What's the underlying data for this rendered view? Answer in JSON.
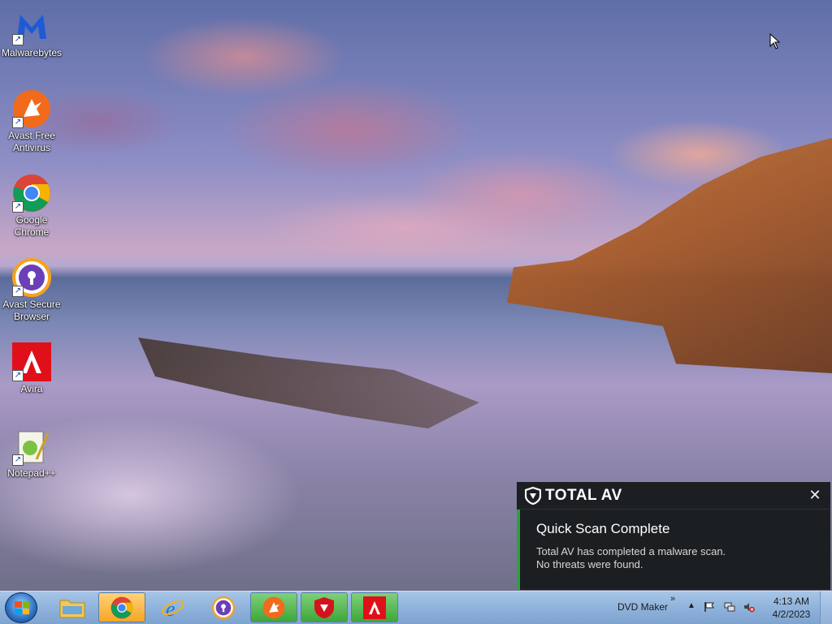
{
  "desktop": {
    "icons": [
      {
        "label": "Malwarebytes",
        "icon": "malwarebytes-icon"
      },
      {
        "label": "Avast Free Antivirus",
        "icon": "avast-antivirus-icon"
      },
      {
        "label": "Google Chrome",
        "icon": "chrome-icon"
      },
      {
        "label": "Avast Secure Browser",
        "icon": "avast-browser-icon"
      },
      {
        "label": "Avira",
        "icon": "avira-icon"
      },
      {
        "label": "Notepad++",
        "icon": "notepadpp-icon"
      }
    ]
  },
  "notification": {
    "brand": "TOTAL AV",
    "title": "Quick Scan Complete",
    "line1": "Total AV has completed a malware scan.",
    "line2": "No threats were found.",
    "close": "✕",
    "accent": "#2ea043"
  },
  "taskbar": {
    "pinned": [
      {
        "name": "explorer",
        "icon": "folder-icon"
      },
      {
        "name": "chrome",
        "icon": "chrome-icon"
      },
      {
        "name": "ie",
        "icon": "internet-explorer-icon"
      },
      {
        "name": "avast-browser",
        "icon": "avast-browser-icon"
      },
      {
        "name": "avast",
        "icon": "avast-antivirus-icon"
      },
      {
        "name": "totalav",
        "icon": "totalav-icon"
      },
      {
        "name": "avira",
        "icon": "avira-icon"
      }
    ],
    "tray_label": "DVD Maker",
    "chevron": "»",
    "overflow": "▲",
    "time": "4:13 AM",
    "date": "4/2/2023"
  }
}
